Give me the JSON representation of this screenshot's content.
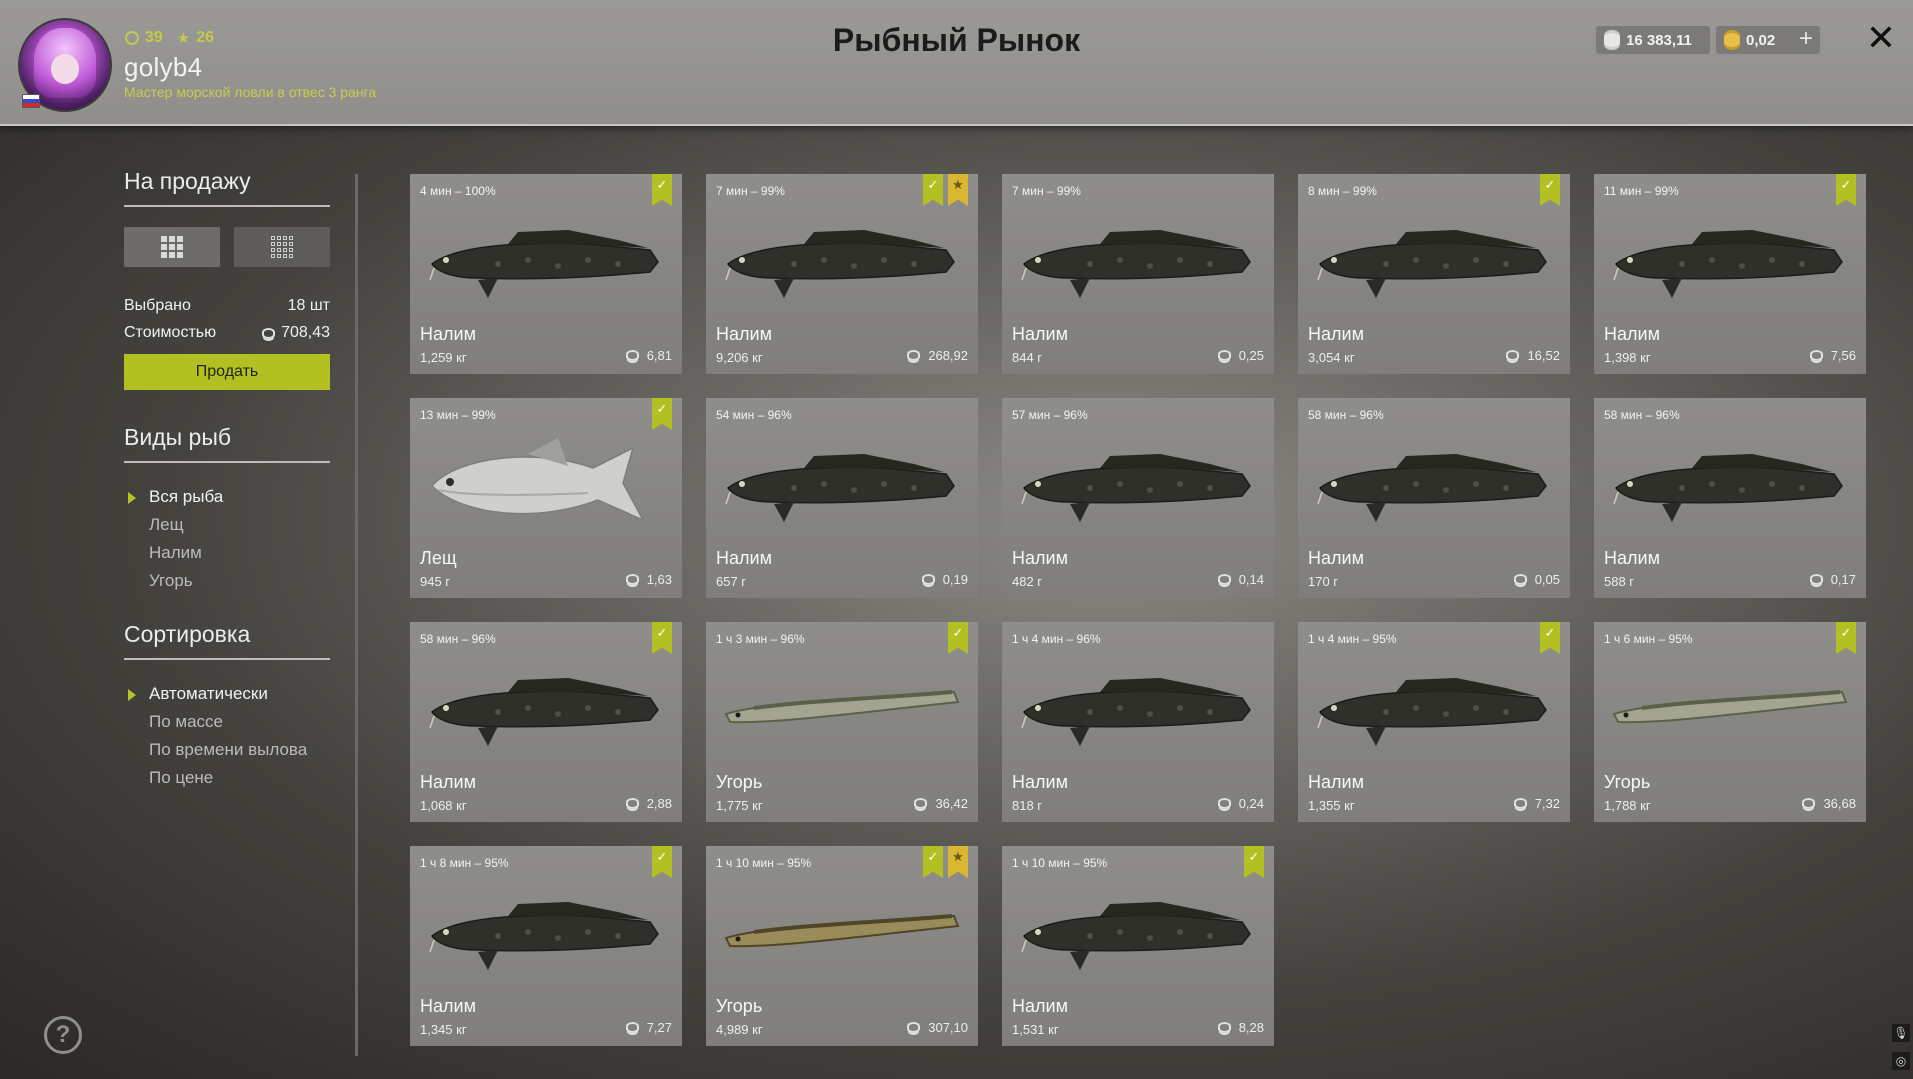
{
  "header": {
    "title": "Рыбный Рынок",
    "player": {
      "level": "39",
      "stars": "26",
      "name": "golyb4",
      "rank": "Мастер морской ловли в отвес 3 ранга"
    },
    "currency": {
      "silver": "16 383,11",
      "gold": "0,02"
    },
    "plus_label": "+",
    "close_label": "✕"
  },
  "sidebar": {
    "for_sale_title": "На продажу",
    "selected_label": "Выбрано",
    "selected_value": "18 шт",
    "cost_label": "Стоимостью",
    "cost_value": "708,43",
    "sell_button": "Продать",
    "species_title": "Виды рыб",
    "species": [
      "Вся рыба",
      "Лещ",
      "Налим",
      "Угорь"
    ],
    "species_active": "Вся рыба",
    "sort_title": "Сортировка",
    "sort": [
      "Автоматически",
      "По массе",
      "По времени вылова",
      "По цене"
    ],
    "sort_active": "Автоматически"
  },
  "fish": [
    {
      "time": "4 мин – 100%",
      "name": "Налим",
      "weight": "1,259 кг",
      "price": "6,81",
      "check": true,
      "star": false,
      "kind": "burbot"
    },
    {
      "time": "7 мин – 99%",
      "name": "Налим",
      "weight": "9,206 кг",
      "price": "268,92",
      "check": true,
      "star": true,
      "kind": "burbot"
    },
    {
      "time": "7 мин – 99%",
      "name": "Налим",
      "weight": "844 г",
      "price": "0,25",
      "check": false,
      "star": false,
      "kind": "burbot"
    },
    {
      "time": "8 мин – 99%",
      "name": "Налим",
      "weight": "3,054 кг",
      "price": "16,52",
      "check": true,
      "star": false,
      "kind": "burbot"
    },
    {
      "time": "11 мин – 99%",
      "name": "Налим",
      "weight": "1,398 кг",
      "price": "7,56",
      "check": true,
      "star": false,
      "kind": "burbot"
    },
    {
      "time": "13 мин – 99%",
      "name": "Лещ",
      "weight": "945 г",
      "price": "1,63",
      "check": true,
      "star": false,
      "kind": "bream"
    },
    {
      "time": "54 мин – 96%",
      "name": "Налим",
      "weight": "657 г",
      "price": "0,19",
      "check": false,
      "star": false,
      "kind": "burbot"
    },
    {
      "time": "57 мин – 96%",
      "name": "Налим",
      "weight": "482 г",
      "price": "0,14",
      "check": false,
      "star": false,
      "kind": "burbot"
    },
    {
      "time": "58 мин – 96%",
      "name": "Налим",
      "weight": "170 г",
      "price": "0,05",
      "check": false,
      "star": false,
      "kind": "burbot"
    },
    {
      "time": "58 мин – 96%",
      "name": "Налим",
      "weight": "588 г",
      "price": "0,17",
      "check": false,
      "star": false,
      "kind": "burbot"
    },
    {
      "time": "58 мин – 96%",
      "name": "Налим",
      "weight": "1,068 кг",
      "price": "2,88",
      "check": true,
      "star": false,
      "kind": "burbot"
    },
    {
      "time": "1 ч 3 мин – 96%",
      "name": "Угорь",
      "weight": "1,775 кг",
      "price": "36,42",
      "check": true,
      "star": false,
      "kind": "eel"
    },
    {
      "time": "1 ч 4 мин – 96%",
      "name": "Налим",
      "weight": "818 г",
      "price": "0,24",
      "check": false,
      "star": false,
      "kind": "burbot"
    },
    {
      "time": "1 ч 4 мин – 95%",
      "name": "Налим",
      "weight": "1,355 кг",
      "price": "7,32",
      "check": true,
      "star": false,
      "kind": "burbot"
    },
    {
      "time": "1 ч 6 мин – 95%",
      "name": "Угорь",
      "weight": "1,788 кг",
      "price": "36,68",
      "check": true,
      "star": false,
      "kind": "eel"
    },
    {
      "time": "1 ч 8 мин – 95%",
      "name": "Налим",
      "weight": "1,345 кг",
      "price": "7,27",
      "check": true,
      "star": false,
      "kind": "burbot"
    },
    {
      "time": "1 ч 10 мин – 95%",
      "name": "Угорь",
      "weight": "4,989 кг",
      "price": "307,10",
      "check": true,
      "star": true,
      "kind": "eel-gold"
    },
    {
      "time": "1 ч 10 мин – 95%",
      "name": "Налим",
      "weight": "1,531 кг",
      "price": "8,28",
      "check": true,
      "star": false,
      "kind": "burbot"
    }
  ],
  "help_label": "?",
  "icons": {
    "check": "✓",
    "star": "★"
  }
}
